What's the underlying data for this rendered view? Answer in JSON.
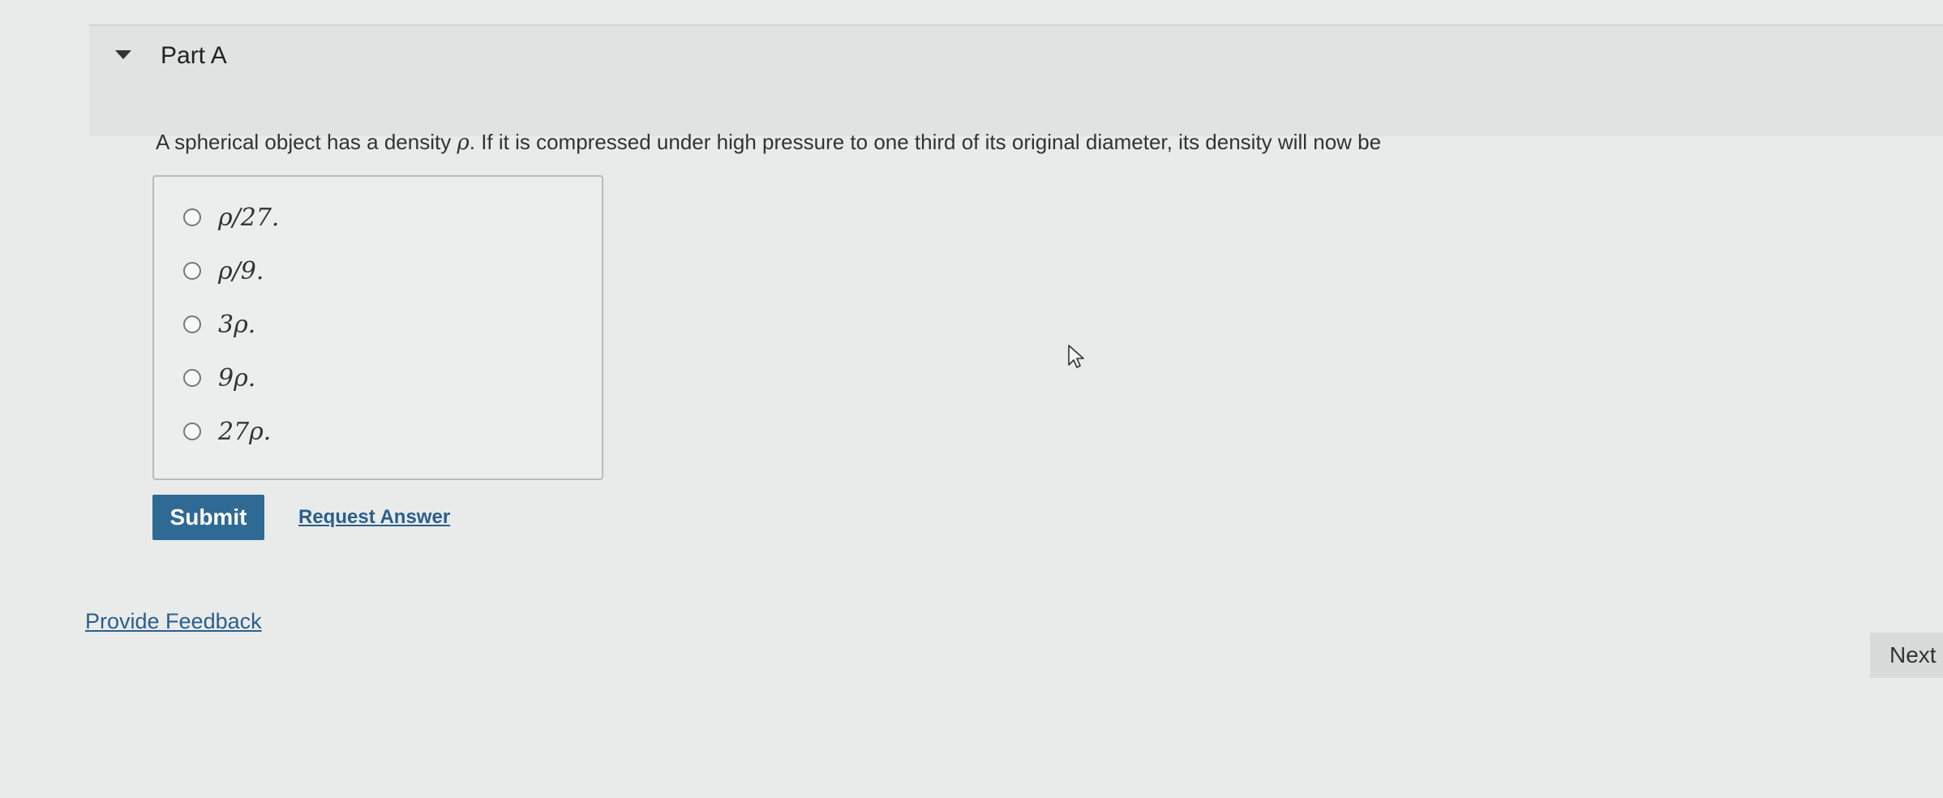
{
  "part": {
    "title": "Part A"
  },
  "question": {
    "text_before": "A spherical object has a density ",
    "symbol": "ρ",
    "text_after": ". If it is compressed under high pressure to one third of its original diameter, its density will now be"
  },
  "choices": [
    {
      "label": "ρ/27."
    },
    {
      "label": "ρ/9."
    },
    {
      "label": "3ρ."
    },
    {
      "label": "9ρ."
    },
    {
      "label": "27ρ."
    }
  ],
  "actions": {
    "submit_label": "Submit",
    "request_answer_label": "Request Answer",
    "provide_feedback_label": "Provide Feedback",
    "next_label": "Next"
  },
  "icons": {
    "collapse": "caret-down-icon",
    "cursor": "mouse-pointer-icon"
  },
  "colors": {
    "submit_bg": "#2f6a94",
    "link": "#2b5f8a",
    "page_bg": "#e9ebea",
    "header_bg": "#e1e3e2"
  }
}
